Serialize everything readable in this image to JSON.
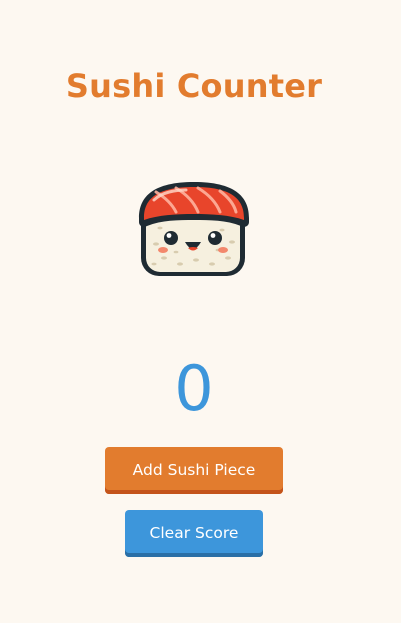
{
  "app": {
    "title": "Sushi Counter"
  },
  "counter": {
    "value": "0"
  },
  "buttons": {
    "add_label": "Add Sushi Piece",
    "clear_label": "Clear Score"
  },
  "icons": {
    "mascot": "sushi-icon"
  },
  "colors": {
    "background": "#fdf8f1",
    "title": "#e27c2e",
    "score": "#3d96db",
    "add_button": "#e27c2e",
    "clear_button": "#3d96db"
  }
}
